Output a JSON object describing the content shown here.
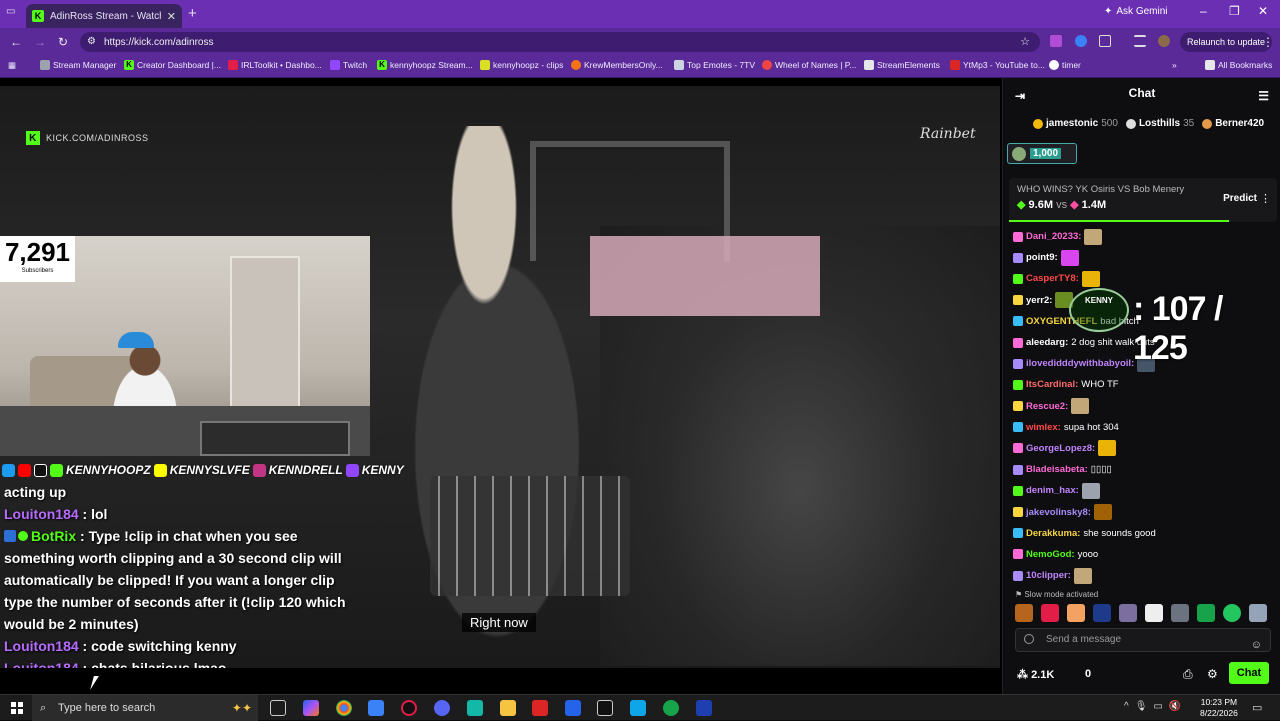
{
  "browser": {
    "tab_title": "AdinRoss Stream - Watch L",
    "tab_close": "✕",
    "new_tab": "+",
    "gemini": "Ask Gemini",
    "url": "https://kick.com/adinross",
    "relaunch": "Relaunch to update",
    "bookmarks": [
      "Stream Manager",
      "Creator Dashboard |...",
      "IRLToolkit • Dashbo...",
      "Twitch",
      "kennyhoopz Stream...",
      "kennyhoopz - clips",
      "KrewMembersOnly...",
      "Top Emotes - 7TV",
      "Wheel of Names | P...",
      "StreamElements",
      "YtMp3 - YouTube to...",
      "timer"
    ],
    "all_bookmarks": "All Bookmarks"
  },
  "video": {
    "kick_url": "KICK.COM/ADINROSS",
    "sponsor": "Rainbet",
    "sub_count": "7,291",
    "sub_label": "Subscribers",
    "socials": [
      "KENNYHOOPZ",
      "KENNYSLVFE",
      "KENNDRELL",
      "KENNY"
    ],
    "caption": "Right now",
    "overlay_chat": [
      {
        "user": "",
        "text": "acting up"
      },
      {
        "user": "Louiton184",
        "text": " : lol"
      },
      {
        "user": "BotRix",
        "text": " : Type !clip in chat when you see something worth clipping and a 30 second clip will automatically be clipped! If you want a longer clip type the number of seconds after it (!clip 120 which would be 2 minutes)"
      },
      {
        "user": "Louiton184",
        "text": " : code switching kenny"
      },
      {
        "user": "Louiton184",
        "text": " : chats hilarious lmao"
      }
    ]
  },
  "chat": {
    "title": "Chat",
    "gifters": [
      {
        "name": "jamestonic",
        "value": "500",
        "color": "#f0b90b"
      },
      {
        "name": "Losthills",
        "value": "35",
        "color": "#dddddd"
      },
      {
        "name": "Berner420",
        "value": "",
        "color": "#e59a4a"
      }
    ],
    "pill_value": "1,000",
    "poll": {
      "question": "WHO WINS? YK Osiris VS Bob Menery",
      "left": "9.6M",
      "vs": "vs",
      "right": "1.4M",
      "button": "Predict",
      "more": "⋮"
    },
    "overlay_counter": ": 107 / 125",
    "overlay_badge": "KENNY",
    "messages": [
      {
        "name": "Dani_20233:",
        "color": "#ff6bd6",
        "text": ""
      },
      {
        "name": "point9:",
        "color": "#ffffff",
        "text": ""
      },
      {
        "name": "CasperTY8:",
        "color": "#ff4a4a",
        "text": ""
      },
      {
        "name": "yerr2:",
        "color": "#ffffff",
        "text": ""
      },
      {
        "name": "OXYGENTHEFL",
        "color": "#f7d640",
        "text": "bad bitch"
      },
      {
        "name": "aleedarg:",
        "color": "#ffffff",
        "text": "2 dog shit walk outs"
      },
      {
        "name": "ilovedidddywithbabyoil:",
        "color": "#c084fc",
        "text": ""
      },
      {
        "name": "ItsCardinal:",
        "color": "#ff6b6b",
        "text": "WHO TF"
      },
      {
        "name": "Rescue2:",
        "color": "#ff6bd6",
        "text": ""
      },
      {
        "name": "wimlex:",
        "color": "#ff4a4a",
        "text": "supa hot 304"
      },
      {
        "name": "GeorgeLopez8:",
        "color": "#c084fc",
        "text": ""
      },
      {
        "name": "Bladeisabeta:",
        "color": "#ff6bd6",
        "text": "▯▯▯▯"
      },
      {
        "name": "denim_hax:",
        "color": "#c084fc",
        "text": ""
      },
      {
        "name": "jakevolinsky8:",
        "color": "#a78bfa",
        "text": ""
      },
      {
        "name": "Derakkuma:",
        "color": "#f7d640",
        "text": "she sounds good"
      },
      {
        "name": "NemoGod:",
        "color": "#53fc18",
        "text": "yooo"
      },
      {
        "name": "10clipper:",
        "color": "#c084fc",
        "text": ""
      }
    ],
    "slow_mode": "Slow mode activated",
    "send_placeholder": "Send a message",
    "likes": "2.1K",
    "zero": "0",
    "chat_button": "Chat"
  },
  "taskbar": {
    "search_placeholder": "Type here to search",
    "time": "10:23 PM",
    "date": "8/22/2026"
  },
  "colors": {
    "browser_purple": "#6b2fb3",
    "kick_green": "#53fc18"
  }
}
